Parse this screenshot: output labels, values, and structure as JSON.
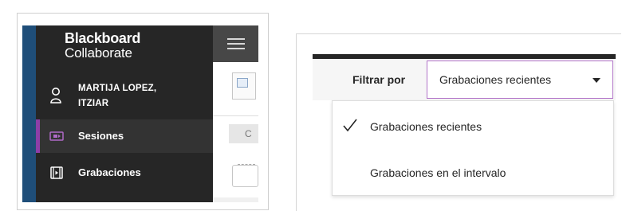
{
  "app": {
    "brand_line1": "Blackboard",
    "brand_line2": "Collaborate",
    "accent": "#8e3ea8",
    "sidebar_bg": "#262626"
  },
  "user": {
    "name_line1": "MARTIJA LOPEZ,",
    "name_line2": "ITZIAR",
    "icon": "user-icon"
  },
  "nav": {
    "items": [
      {
        "label": "Sesiones",
        "icon": "sessions-icon",
        "active": true
      },
      {
        "label": "Grabaciones",
        "icon": "recordings-icon",
        "active": false
      }
    ]
  },
  "content": {
    "button_label": "C"
  },
  "filter": {
    "label": "Filtrar por",
    "selected": "Grabaciones recientes",
    "select_border": "#b274c8",
    "options": [
      {
        "label": "Grabaciones recientes",
        "checked": true
      },
      {
        "label": "Grabaciones en el intervalo",
        "checked": false
      }
    ]
  }
}
